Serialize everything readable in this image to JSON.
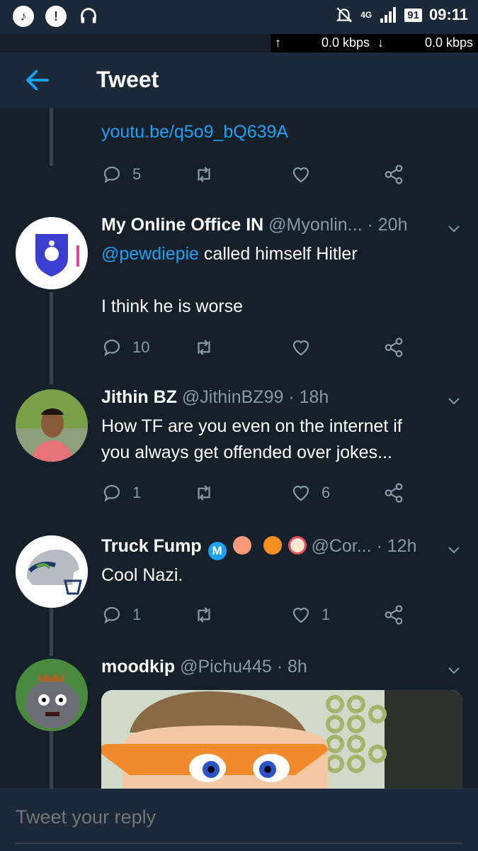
{
  "status_bar": {
    "time": "09:11",
    "battery": "91",
    "network": "4G",
    "upload_speed": "0.0 kbps",
    "download_speed": "0.0 kbps"
  },
  "header": {
    "title": "Tweet"
  },
  "parent_tweet": {
    "link": "youtu.be/q5o9_bQ639A",
    "replies": "5",
    "likes": ""
  },
  "tweets": [
    {
      "name": "My Online Office IN",
      "handle": "@Myonlin...",
      "time": "· 20h",
      "mention": "@pewdiepie",
      "text_line1": " called himself Hitler",
      "text_line2": "I think he is worse",
      "replies": "10",
      "likes": ""
    },
    {
      "name": "Jithin BZ",
      "handle": "@JithinBZ99",
      "time": "· 18h",
      "text_line1": "How TF are you even on the internet if",
      "text_line2": "you always get offended over jokes...",
      "replies": "1",
      "likes": "6"
    },
    {
      "name": "Truck Fump",
      "handle": "@Cor...",
      "time": "· 12h",
      "text_line1": "Cool Nazi.",
      "replies": "1",
      "likes": "1"
    },
    {
      "name": "moodkip",
      "handle": "@Pichu445",
      "time": "· 8h"
    }
  ],
  "reply": {
    "placeholder": "Tweet your reply"
  },
  "colors": {
    "background": "#15202b",
    "bar": "#1c2938",
    "accent": "#1da1f2",
    "muted": "#8899a6"
  }
}
